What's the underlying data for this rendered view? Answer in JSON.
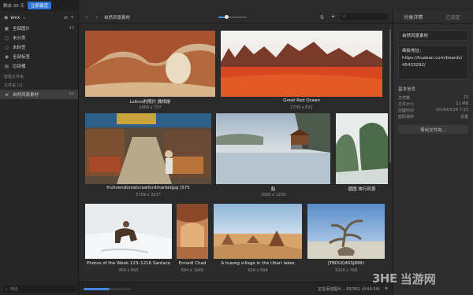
{
  "topbar": {
    "days_left": "剩余 30 天",
    "upgrade_label": "立即激活"
  },
  "library": {
    "name": "wxx",
    "chevron": "⌄"
  },
  "nav": [
    {
      "label": "全部图片",
      "count": "43",
      "icon": "all-images-icon"
    },
    {
      "label": "未分类",
      "count": "",
      "icon": "uncategorized-icon"
    },
    {
      "label": "未标签",
      "count": "",
      "icon": "untagged-icon"
    },
    {
      "label": "全部标签",
      "count": "",
      "icon": "tags-icon"
    },
    {
      "label": "垃圾桶",
      "count": "",
      "icon": "trash-icon"
    }
  ],
  "sections": {
    "smart_folders": "智能文件夹",
    "folders": "文件夹 (1)"
  },
  "folder": {
    "label": "自然风景素材",
    "count": "43"
  },
  "sidebar_search": {
    "placeholder": "筛选"
  },
  "toolbar": {
    "folder_title": "自然风景素材",
    "zoom_level": 0.28
  },
  "images": [
    {
      "title": "Lsltrm的照片 微相册",
      "dims": "1600 x 757"
    },
    {
      "title": "Great Red Ocean",
      "dims": "1700 x 632"
    },
    {
      "title": "fruitvendorsatcrawfordmarketjpg (575",
      "dims": "5759 x 3237"
    },
    {
      "title": "船",
      "dims": "1920 x 1200"
    },
    {
      "title": "圈图 旅行风景",
      "dims": ""
    },
    {
      "title": "Photos of the Week 123–1216 Santaco",
      "dims": "900 x 600"
    },
    {
      "title": "Ennedi Chad",
      "dims": "564 x 1049"
    },
    {
      "title": "A tuareg village in the Ubari lakes",
      "dims": "564 x 564"
    },
    {
      "title": "JTBDUQ4SSJ6MU",
      "dims": "1024 x 768"
    }
  ],
  "status": {
    "progress": 0.55,
    "text": "正在添加图片... 65/561 (0:00:54)"
  },
  "rpanel": {
    "tab_details": "分类详情",
    "tab_selected": "已选定",
    "folder_name": "自然风景素材",
    "url_label": "画板地址：",
    "url_value": "https://huaban.com/boards/45433292/",
    "basic_title": "基本信息",
    "info": [
      {
        "k": "文件数",
        "v": "23"
      },
      {
        "k": "文件大小",
        "v": "11 MB"
      },
      {
        "k": "创建时间",
        "v": "2019/03/16 7:23"
      },
      {
        "k": "密码保护",
        "v": "设置"
      }
    ],
    "export_label": "导出文件夹..."
  },
  "watermark": {
    "logo": "3HE",
    "text": "当游网"
  },
  "colors": {
    "accent": "#2d74d8",
    "progress": "#3f86e6"
  }
}
